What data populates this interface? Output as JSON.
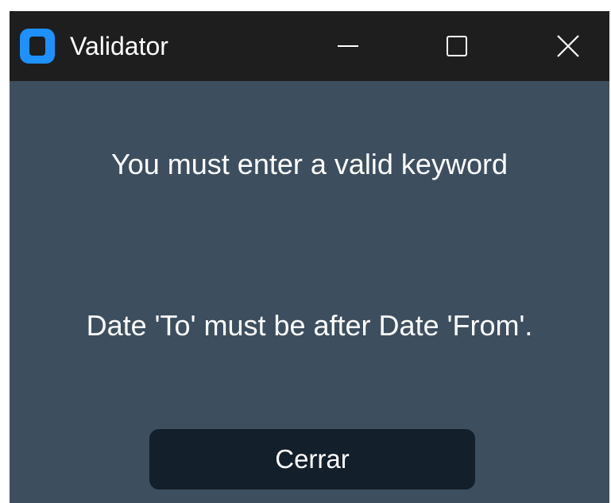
{
  "window": {
    "title": "Validator",
    "app_icon": "app-icon",
    "controls": {
      "minimize_icon": "minimize-icon",
      "maximize_icon": "maximize-icon",
      "close_icon": "close-icon"
    }
  },
  "dialog": {
    "messages": [
      "You must enter a valid keyword",
      "Date 'To' must be after Date 'From'."
    ],
    "close_button_label": "Cerrar"
  },
  "colors": {
    "titlebar": "#1e1e1e",
    "background": "#3d4e5f",
    "button": "#131f2a",
    "accent": "#1e90ff",
    "text": "#ffffff"
  }
}
